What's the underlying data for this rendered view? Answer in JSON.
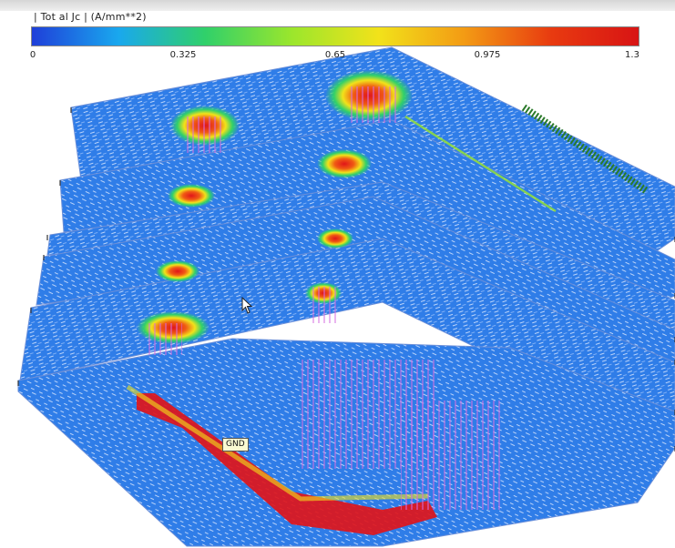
{
  "legend": {
    "title": "| Tot al Jc | (A/mm**2)",
    "tick_labels": [
      "0",
      "0.325",
      "0.65",
      "0.975",
      "1.3"
    ],
    "range": [
      0,
      1.3
    ],
    "gradient_colors": [
      "#1f3fd9",
      "#19a8ee",
      "#30d06a",
      "#9be62c",
      "#f2e21a",
      "#f39a14",
      "#e83a10",
      "#d81414"
    ]
  },
  "scene": {
    "net_label": "GND",
    "layer_count": 6,
    "plane_color": "#2f7de8",
    "vector_color": "#e8f1ff",
    "hotspot_color": "#e0151a",
    "via_color": "#d66ee0",
    "trace_color": "#2a7a2a"
  }
}
